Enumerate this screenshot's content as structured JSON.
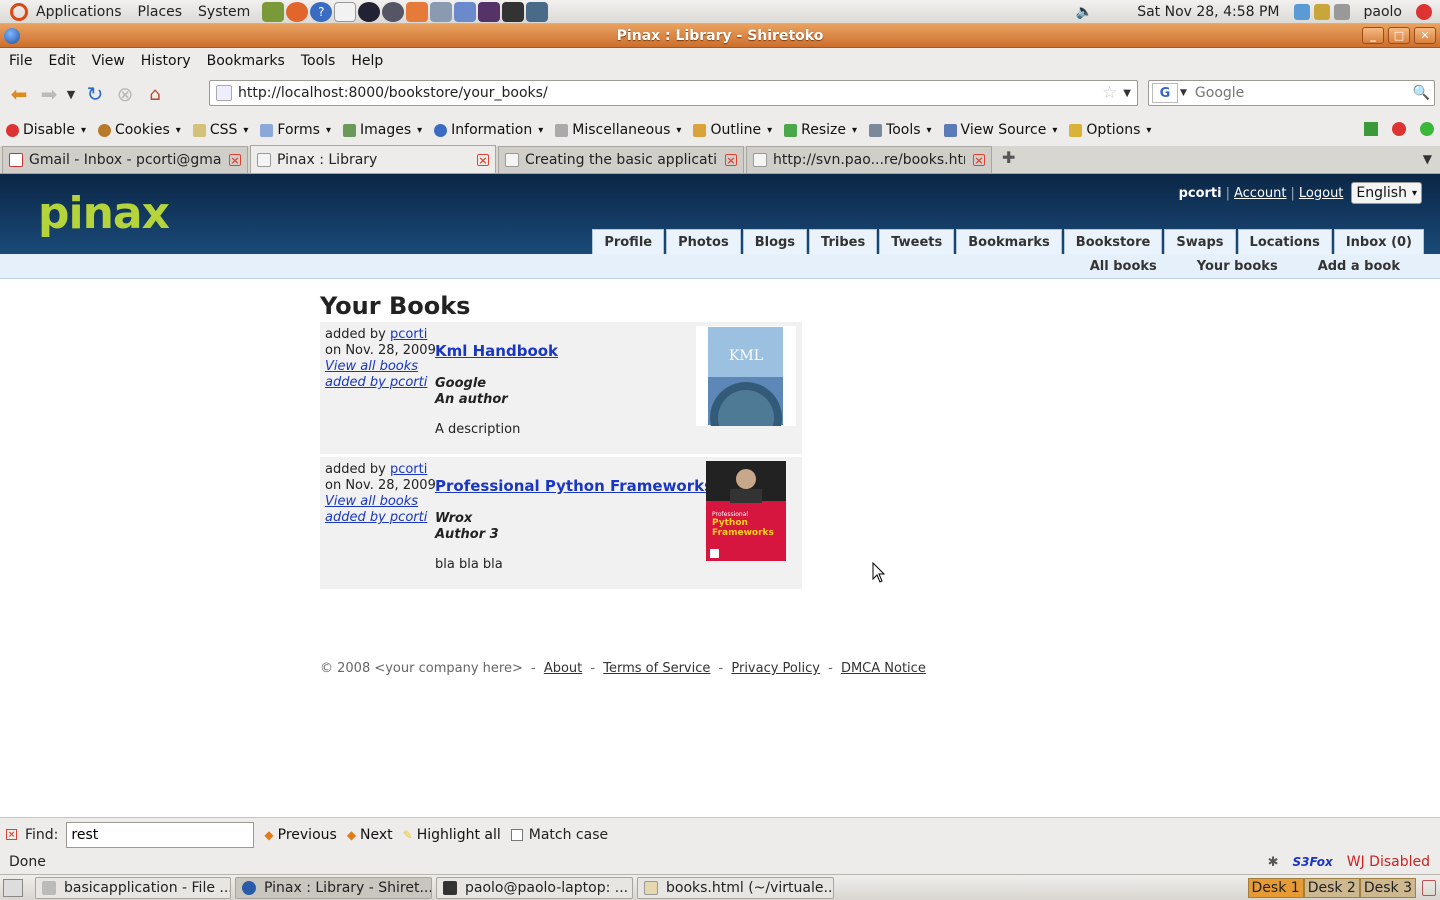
{
  "gnome_panel": {
    "menus": [
      "Applications",
      "Places",
      "System"
    ],
    "clock": "Sat Nov 28,  4:58 PM",
    "user": "paolo"
  },
  "window": {
    "title": "Pinax : Library - Shiretoko"
  },
  "menubar": [
    "File",
    "Edit",
    "View",
    "History",
    "Bookmarks",
    "Tools",
    "Help"
  ],
  "navbar": {
    "url": "http://localhost:8000/bookstore/your_books/",
    "search_placeholder": "Google",
    "search_engine_letter": "G"
  },
  "webdev_toolbar": [
    "Disable",
    "Cookies",
    "CSS",
    "Forms",
    "Images",
    "Information",
    "Miscellaneous",
    "Outline",
    "Resize",
    "Tools",
    "View Source",
    "Options"
  ],
  "tabs": [
    {
      "label": "Gmail - Inbox - pcorti@gmai...",
      "active": false
    },
    {
      "label": "Pinax : Library",
      "active": true
    },
    {
      "label": "Creating the basic applicatio...",
      "active": false
    },
    {
      "label": "http://svn.pao...re/books.html",
      "active": false
    }
  ],
  "site": {
    "logo": "pinax",
    "user": {
      "name": "pcorti",
      "account": "Account",
      "logout": "Logout",
      "language": "English"
    },
    "main_nav": [
      "Profile",
      "Photos",
      "Blogs",
      "Tribes",
      "Tweets",
      "Bookmarks",
      "Bookstore",
      "Swaps",
      "Locations",
      "Inbox (0)"
    ],
    "sub_nav": [
      "All books",
      "Your books",
      "Add a book"
    ],
    "heading": "Your Books",
    "books": [
      {
        "added_by_prefix": "added by ",
        "added_by": "pcorti",
        "date": "on Nov. 28, 2009",
        "view_all_1": "View all books",
        "view_all_2": "added by pcorti",
        "title": "Kml Handbook",
        "publisher": "Google",
        "author": "An author",
        "description": "A description",
        "cover_text": "KML"
      },
      {
        "added_by_prefix": "added by ",
        "added_by": "pcorti",
        "date": "on Nov. 28, 2009",
        "view_all_1": "View all books",
        "view_all_2": "added by pcorti",
        "title": "Professional Python Frameworks",
        "publisher": "Wrox",
        "author": "Author 3",
        "description": "bla bla bla",
        "cover_line1": "Professional",
        "cover_line2": "Python",
        "cover_line3": "Frameworks"
      }
    ],
    "footer": {
      "copyright": "© 2008 <your company here>",
      "links": [
        "About",
        "Terms of Service",
        "Privacy Policy",
        "DMCA Notice"
      ]
    }
  },
  "findbar": {
    "label": "Find:",
    "value": "rest",
    "previous": "Previous",
    "next": "Next",
    "highlight": "Highlight all",
    "match_case": "Match case"
  },
  "statusbar": {
    "status": "Done",
    "s3fox": "S3Fox",
    "wj": "WJ Disabled"
  },
  "taskbar": {
    "tasks": [
      {
        "label": "basicapplication - File ...",
        "active": false
      },
      {
        "label": "Pinax : Library - Shiret...",
        "active": true
      },
      {
        "label": "paolo@paolo-laptop: ...",
        "active": false
      },
      {
        "label": "books.html (~/virtuale...",
        "active": false
      }
    ],
    "desks": [
      "Desk 1",
      "Desk 2",
      "Desk 3"
    ]
  }
}
